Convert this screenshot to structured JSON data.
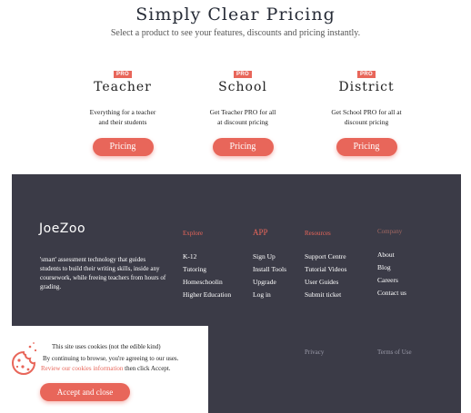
{
  "hero": {
    "title": "Simply Clear Pricing",
    "subtitle": "Select a product to see your features, discounts and pricing instantly."
  },
  "plans": [
    {
      "badge": "PRO",
      "name": "Teacher",
      "desc_line1": "Everything for a teacher",
      "desc_line2": "and their students",
      "button": "Pricing"
    },
    {
      "badge": "PRO",
      "name": "School",
      "desc_line1": "Get Teacher PRO for all",
      "desc_line2": "at discount pricing",
      "button": "Pricing"
    },
    {
      "badge": "PRO",
      "name": "District",
      "desc_line1": "Get School PRO for all at",
      "desc_line2": "discount pricing",
      "button": "Pricing"
    }
  ],
  "footer": {
    "logo": "JoeZoo",
    "tagline": "'smart' assessment technology that guides students to build their writing skills, inside any coursework, while freeing teachers from hours of grading.",
    "columns": [
      {
        "heading": "Explore",
        "links": [
          "K-12",
          "Tutoring",
          "Homeschoolin",
          "Higher Education"
        ]
      },
      {
        "heading": "APP",
        "links": [
          "Sign Up",
          "Install Tools",
          "Upgrade",
          "Log in"
        ]
      },
      {
        "heading": "Resources",
        "links": [
          "Support Centre",
          "Tutorial Videos",
          "User Guides",
          "Submit ticket"
        ]
      },
      {
        "heading": "Company",
        "links": [
          "About",
          "Blog",
          "Careers",
          "Contact us"
        ]
      }
    ],
    "bottom_links": {
      "privacy": "Privacy",
      "terms": "Terms of Use"
    }
  },
  "cookie_banner": {
    "line1": "This site uses cookies (not the edible kind)",
    "line2": "By continuing to browse, you're agreeing to our uses.",
    "link": "Review our cookies information",
    "line3_suffix": " then click Accept.",
    "button": "Accept and close",
    "icon": "cookie-icon"
  },
  "colors": {
    "accent": "#e8665a",
    "footer_bg": "#3b3b47"
  }
}
